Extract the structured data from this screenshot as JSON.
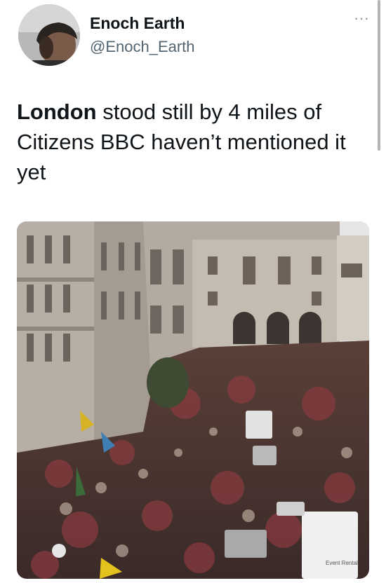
{
  "author": {
    "display_name": "Enoch Earth",
    "handle": "@Enoch_Earth",
    "avatar_icon": "profile-photo"
  },
  "more_icon": "more-options-icon",
  "tweet": {
    "bold_word": "London",
    "text_rest": " stood still by 4 miles of Citizens  BBC haven’t mentioned it yet"
  },
  "media": {
    "type": "photo",
    "description_icon": "crowd-photo",
    "van_sign": "Event Rental"
  }
}
